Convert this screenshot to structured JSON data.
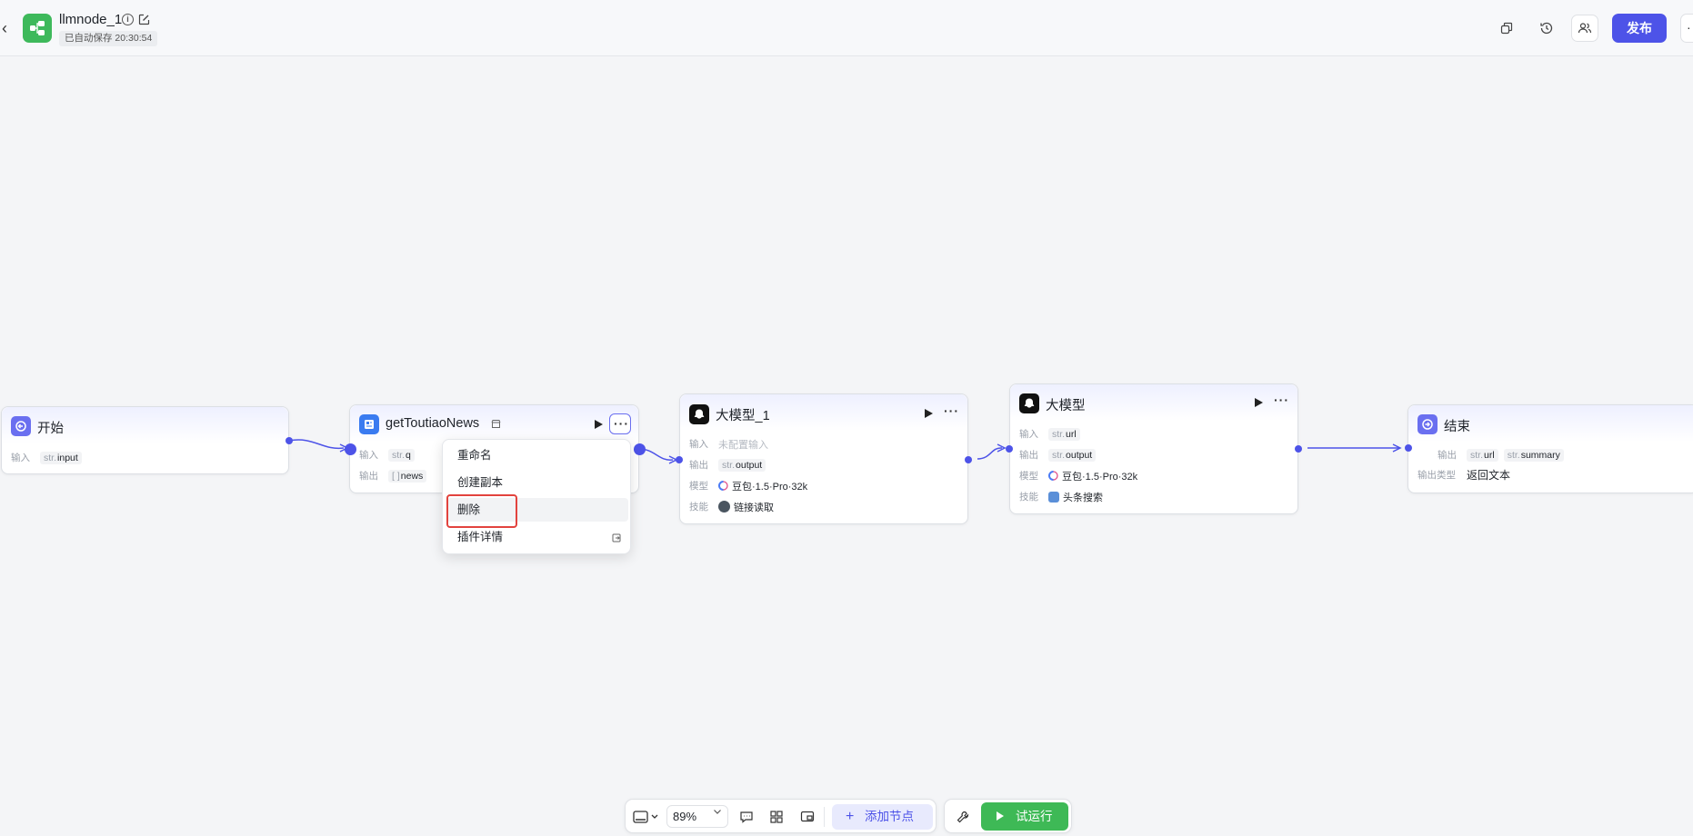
{
  "header": {
    "title": "llmnode_1",
    "autosave": "已自动保存 20:30:54",
    "publish_label": "发布"
  },
  "nodes": {
    "start": {
      "title": "开始",
      "input_label": "输入",
      "input_type": "str.",
      "input_name": "input"
    },
    "plugin": {
      "title": "getToutiaoNews",
      "input_label": "输入",
      "input_type": "str.",
      "input_name": "q",
      "output_label": "输出",
      "output_type": "[ ]",
      "output_name": "news"
    },
    "llm1": {
      "title": "大模型_1",
      "input_label": "输入",
      "input_value": "未配置输入",
      "output_label": "输出",
      "output_type": "str.",
      "output_name": "output",
      "model_label": "模型",
      "model_value": "豆包·1.5·Pro·32k",
      "skill_label": "技能",
      "skill_value": "链接读取"
    },
    "llm2": {
      "title": "大模型",
      "input_label": "输入",
      "input_type": "str.",
      "input_name": "url",
      "output_label": "输出",
      "output_type": "str.",
      "output_name": "output",
      "model_label": "模型",
      "model_value": "豆包·1.5·Pro·32k",
      "skill_label": "技能",
      "skill_value": "头条搜索"
    },
    "end": {
      "title": "结束",
      "output_label": "输出",
      "output_type1": "str.",
      "output_name1": "url",
      "output_type2": "str.",
      "output_name2": "summary",
      "output_kind_label": "输出类型",
      "output_kind_value": "返回文本"
    }
  },
  "context_menu": {
    "items": [
      "重命名",
      "创建副本",
      "删除",
      "插件详情"
    ]
  },
  "toolbar": {
    "zoom": "89%",
    "add_node_label": "添加节点",
    "trial_run_label": "试运行"
  },
  "colors": {
    "accent": "#4d53e8",
    "green": "#3eb956",
    "danger": "#e2433e"
  }
}
